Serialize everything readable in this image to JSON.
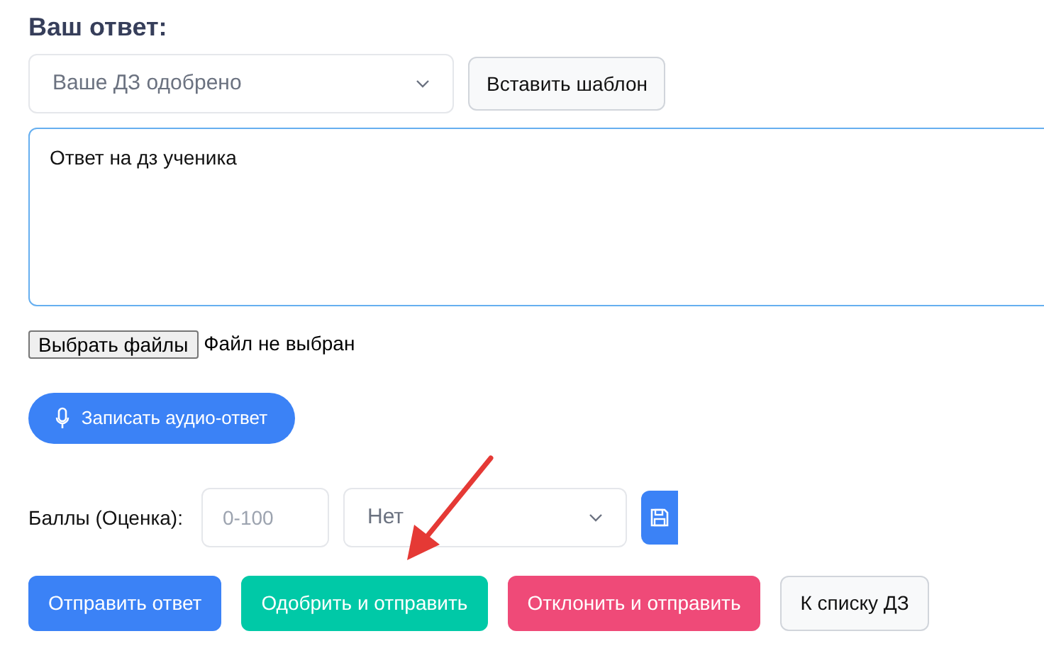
{
  "heading": "Ваш ответ:",
  "template_select": {
    "value": "Ваше ДЗ одобрено"
  },
  "insert_template_button": "Вставить шаблон",
  "answer": {
    "value": "Ответ на дз ученика"
  },
  "file": {
    "button": "Выбрать файлы",
    "status": "Файл не выбран"
  },
  "audio_button": "Записать аудио-ответ",
  "score": {
    "label": "Баллы (Оценка):",
    "placeholder": "0-100",
    "select_value": "Нет"
  },
  "actions": [
    {
      "label": "Отправить ответ",
      "kind": "primary"
    },
    {
      "label": "Одобрить и отправить",
      "kind": "success"
    },
    {
      "label": "Отклонить и отправить",
      "kind": "danger"
    },
    {
      "label": "К списку ДЗ",
      "kind": "secondary"
    }
  ]
}
